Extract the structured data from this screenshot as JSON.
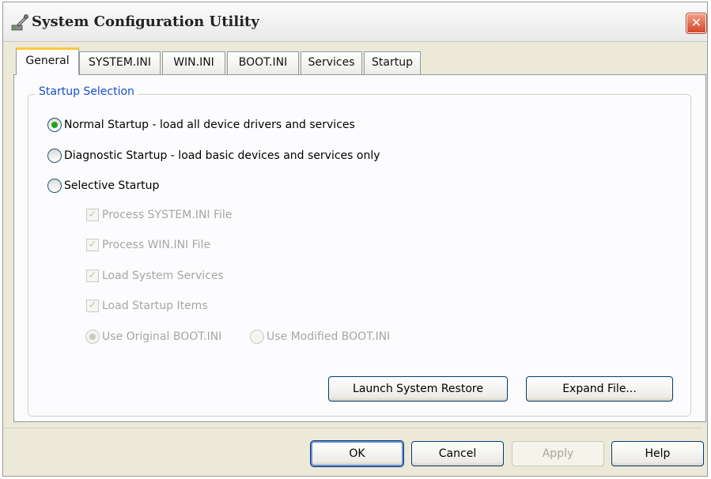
{
  "window": {
    "title": "System Configuration Utility",
    "icon": "system-config-icon",
    "close_glyph": "✕"
  },
  "tabs": [
    {
      "label": "General",
      "active": true
    },
    {
      "label": "SYSTEM.INI",
      "active": false
    },
    {
      "label": "WIN.INI",
      "active": false
    },
    {
      "label": "BOOT.INI",
      "active": false
    },
    {
      "label": "Services",
      "active": false
    },
    {
      "label": "Startup",
      "active": false
    }
  ],
  "startup_selection": {
    "legend": "Startup Selection",
    "options": [
      {
        "label": "Normal Startup - load all device drivers and services",
        "checked": true
      },
      {
        "label": "Diagnostic Startup - load basic devices and services only",
        "checked": false
      },
      {
        "label": "Selective Startup",
        "checked": false
      }
    ],
    "selective": {
      "checkboxes": [
        {
          "label": "Process SYSTEM.INI File",
          "checked": true,
          "enabled": false
        },
        {
          "label": "Process WIN.INI File",
          "checked": true,
          "enabled": false
        },
        {
          "label": "Load System Services",
          "checked": true,
          "enabled": false
        },
        {
          "label": "Load Startup Items",
          "checked": true,
          "enabled": false
        }
      ],
      "boot_options": [
        {
          "label": "Use Original BOOT.INI",
          "checked": true,
          "enabled": false
        },
        {
          "label": "Use Modified BOOT.INI",
          "checked": false,
          "enabled": false
        }
      ]
    }
  },
  "panel_buttons": {
    "launch_restore": "Launch System Restore",
    "expand_file": "Expand File..."
  },
  "dialog_buttons": {
    "ok": "OK",
    "cancel": "Cancel",
    "apply": "Apply",
    "help": "Help"
  },
  "colors": {
    "accent_blue": "#1550c7",
    "close_red": "#d6462a",
    "tab_highlight": "#ffc83c",
    "radio_selected": "#21a121"
  }
}
